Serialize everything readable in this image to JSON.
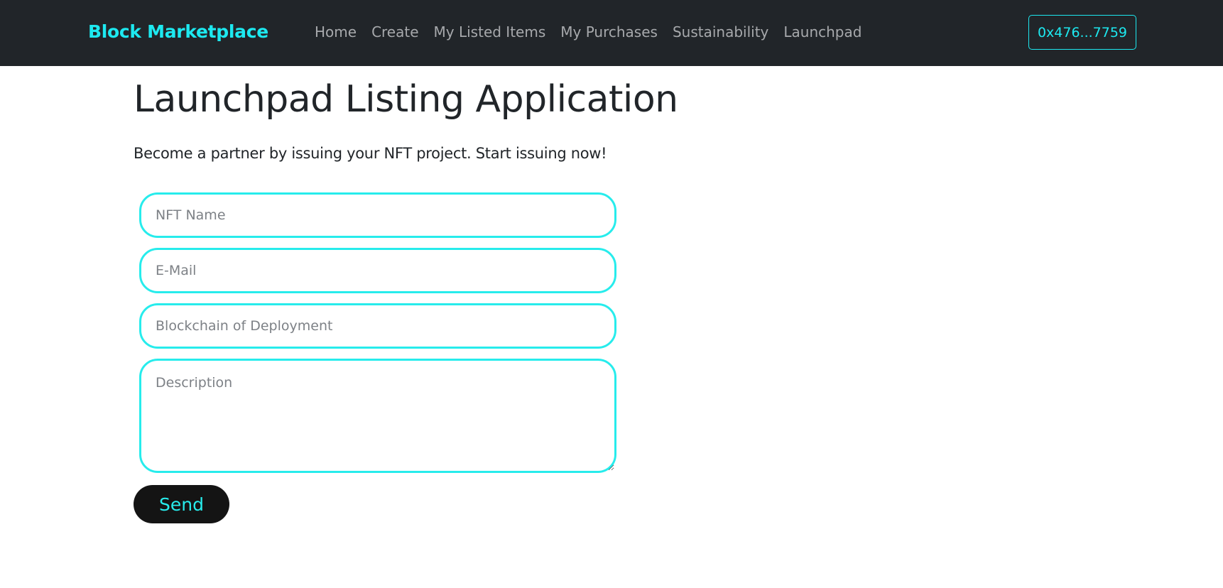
{
  "navbar": {
    "brand": "Block Marketplace",
    "links": [
      {
        "label": "Home"
      },
      {
        "label": "Create"
      },
      {
        "label": "My Listed Items"
      },
      {
        "label": "My Purchases"
      },
      {
        "label": "Sustainability"
      },
      {
        "label": "Launchpad"
      }
    ],
    "wallet": "0x476...7759"
  },
  "page": {
    "title": "Launchpad Listing Application",
    "subtitle": "Become a partner by issuing your NFT project. Start issuing now!"
  },
  "form": {
    "nft_name": {
      "placeholder": "NFT Name",
      "value": ""
    },
    "email": {
      "placeholder": "E-Mail",
      "value": ""
    },
    "blockchain": {
      "placeholder": "Blockchain of Deployment",
      "value": ""
    },
    "description": {
      "placeholder": "Description",
      "value": ""
    },
    "send_label": "Send"
  },
  "colors": {
    "navbar_bg": "#212529",
    "accent": "#1de9f0",
    "nav_link": "#a7a9ac",
    "button_bg": "#141414",
    "text": "#212529"
  }
}
